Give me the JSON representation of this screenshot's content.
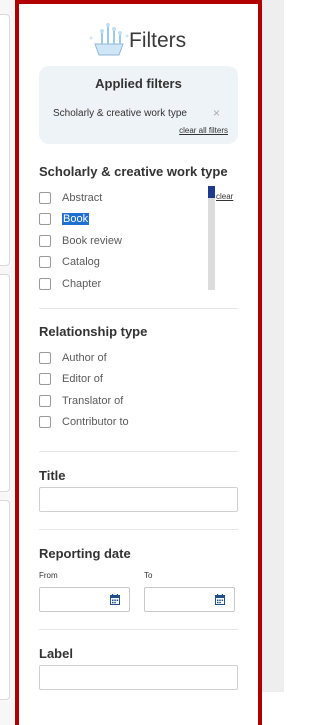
{
  "panel": {
    "title": "Filters",
    "colors": {
      "border": "#b20000",
      "applied_bg": "#eef3f7",
      "selected": "#1f6fd1",
      "scroll_thumb": "#1e3a8a"
    }
  },
  "applied": {
    "heading": "Applied filters",
    "chip_label": "Scholarly & creative work type",
    "chip_remove": "×",
    "clear_all": "clear all filters"
  },
  "work_type": {
    "title": "Scholarly & creative work type",
    "clear": "clear",
    "options": [
      {
        "label": "Abstract",
        "selected": false
      },
      {
        "label": "Book",
        "selected": true
      },
      {
        "label": "Book review",
        "selected": false
      },
      {
        "label": "Catalog",
        "selected": false
      },
      {
        "label": "Chapter",
        "selected": false
      }
    ]
  },
  "relationship": {
    "title": "Relationship type",
    "options": [
      {
        "label": "Author of"
      },
      {
        "label": "Editor of"
      },
      {
        "label": "Translator of"
      },
      {
        "label": "Contributor to"
      }
    ]
  },
  "title_filter": {
    "title": "Title",
    "value": ""
  },
  "reporting_date": {
    "title": "Reporting date",
    "from_label": "From",
    "to_label": "To",
    "from_value": "",
    "to_value": "",
    "icon": "calendar-icon"
  },
  "label_filter": {
    "title": "Label",
    "value": ""
  }
}
